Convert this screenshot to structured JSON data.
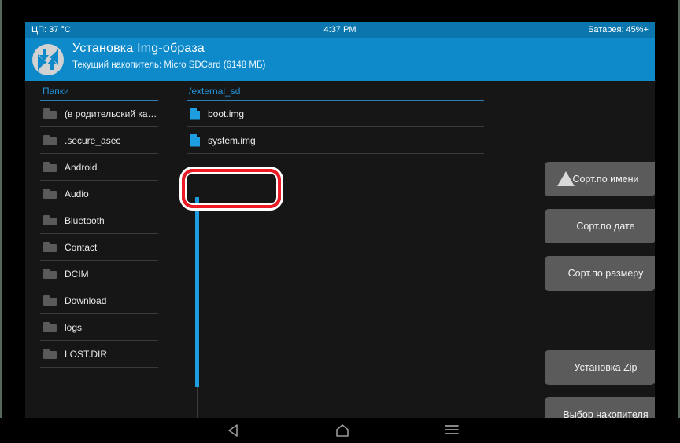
{
  "statusbar": {
    "cpu": "ЦП: 37 °C",
    "time": "4:37 PM",
    "battery": "Батарея: 45%+"
  },
  "header": {
    "logo_icon": "twrp-logo-icon",
    "title": "Установка Img-образа",
    "subtitle": "Текущий накопитель: Micro SDCard (6148 МБ)"
  },
  "columns": {
    "folders_header": "Папки",
    "files_header": "/external_sd"
  },
  "folders": [
    {
      "icon": "folder-icon",
      "label": "(в родительский каталог)"
    },
    {
      "icon": "folder-icon",
      "label": ".secure_asec"
    },
    {
      "icon": "folder-icon",
      "label": "Android"
    },
    {
      "icon": "folder-icon",
      "label": "Audio"
    },
    {
      "icon": "folder-icon",
      "label": "Bluetooth"
    },
    {
      "icon": "folder-icon",
      "label": "Contact"
    },
    {
      "icon": "folder-icon",
      "label": "DCIM"
    },
    {
      "icon": "folder-icon",
      "label": "Download"
    },
    {
      "icon": "folder-icon",
      "label": "logs"
    },
    {
      "icon": "folder-icon",
      "label": "LOST.DIR"
    },
    {
      "icon": "folder-icon",
      "label": ""
    }
  ],
  "files": [
    {
      "icon": "file-icon",
      "label": "boot.img",
      "highlighted": true
    },
    {
      "icon": "file-icon",
      "label": "system.img",
      "highlighted": false
    }
  ],
  "buttons": [
    {
      "name": "sort-by-name",
      "label": "Сорт.по имени",
      "icon": "triangle-up-icon"
    },
    {
      "name": "sort-by-date",
      "label": "Сорт.по дате",
      "icon": ""
    },
    {
      "name": "sort-by-size",
      "label": "Сорт.по размеру",
      "icon": ""
    },
    {
      "name": "install-zip",
      "label": "Установка Zip",
      "icon": ""
    },
    {
      "name": "select-storage",
      "label": "Выбор накопителя",
      "icon": ""
    }
  ],
  "navbar": {
    "back_icon": "back-triangle-icon",
    "home_icon": "home-icon",
    "menu_icon": "menu-lines-icon"
  },
  "annotation": {
    "target": "boot.img",
    "shape": "rounded-rect-highlight",
    "color": "#ee1b24"
  },
  "colors": {
    "status_bar": "#0b76ad",
    "header": "#0e8acb",
    "accent": "#1e9ee0",
    "background": "#161616",
    "button": "#5b5b5b",
    "annotation": "#ee1b24"
  }
}
